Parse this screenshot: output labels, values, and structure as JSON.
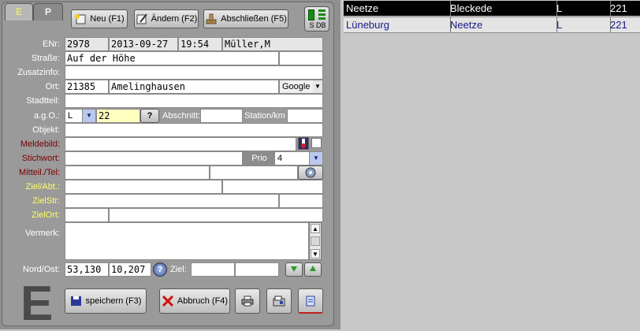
{
  "tabs": {
    "e": "E",
    "p": "P"
  },
  "toolbar": {
    "new": "Neu (F1)",
    "edit": "Ändern (F2)",
    "close": "Abschließen (F5)",
    "status_indicator": "S DB"
  },
  "labels": {
    "enr": "ENr:",
    "strasse": "Straße:",
    "zusatzinfo": "Zusatzinfo:",
    "ort": "Ort:",
    "stadtteil": "Stadtteil:",
    "ago": "a.g.O.:",
    "objekt": "Objekt:",
    "meldebild": "Meldebild:",
    "stichwort": "Stichwort:",
    "mitteil": "Mitteil./Tel:",
    "ziel_abt": "Ziel/Abt.:",
    "ziel_str": "ZielStr:",
    "ziel_ort": "ZielOrt:",
    "vermerk": "Vermerk:",
    "nord_ost": "Nord/Ost:",
    "abschnitt": "Abschnitt:",
    "station": "Station/km",
    "prio": "Prio",
    "ziel": "Ziel:"
  },
  "fields": {
    "enr": "2978",
    "date": "2013-09-27",
    "time": "19:54",
    "user": "Müller,M",
    "strasse": "Auf der Höhe",
    "plz": "21385",
    "ort": "Amelinghausen",
    "map_provider": "Google",
    "ago_type": "L",
    "ago_number": "22",
    "ago_help": "?",
    "prio": "4",
    "nord": "53,130",
    "ost": "10,207"
  },
  "footer": {
    "save": "speichern (F3)",
    "cancel": "Abbruch (F4)",
    "big_letter": "E"
  },
  "results_table": {
    "rows": [
      [
        "Neetze",
        "Bleckede",
        "L",
        "221"
      ],
      [
        "Lüneburg",
        "Neetze",
        "L",
        "221"
      ]
    ]
  },
  "colors": {
    "selected_row_bg": "#000000",
    "selected_row_fg": "#ffffff",
    "normal_row_text": "#1a1a8a",
    "highlight_field": "#ffffc0",
    "required_label": "#7a0000",
    "target_label": "#ffff66"
  }
}
